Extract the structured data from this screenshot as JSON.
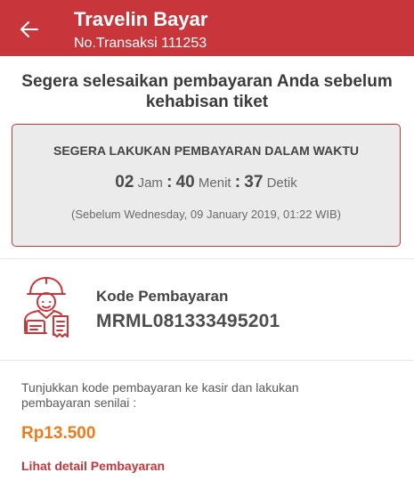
{
  "header": {
    "title": "Travelin Bayar",
    "transaction": "No.Transaksi 111253",
    "color": "#c8353a"
  },
  "urge_text": "Segera selesaikan pembayaran Anda sebelum kehabisan tiket",
  "timer": {
    "heading": "SEGERA LAKUKAN PEMBAYARAN DALAM WAKTU",
    "hours": "02",
    "hours_unit": "Jam",
    "minutes": "40",
    "minutes_unit": "Menit",
    "seconds": "37",
    "seconds_unit": "Detik",
    "deadline_note": "(Sebelum Wednesday, 09 January 2019, 01:22 WIB)"
  },
  "payment_code": {
    "label": "Kode Pembayaran",
    "value": "MRML081333495201",
    "icon": "cashier-icon"
  },
  "instruction": "Tunjukkan kode pembayaran ke kasir dan lakukan pembayaran senilai :",
  "amount": "Rp13.500",
  "amount_color": "#f07a1a",
  "detail_link": "Lihat detail Pembayaran"
}
